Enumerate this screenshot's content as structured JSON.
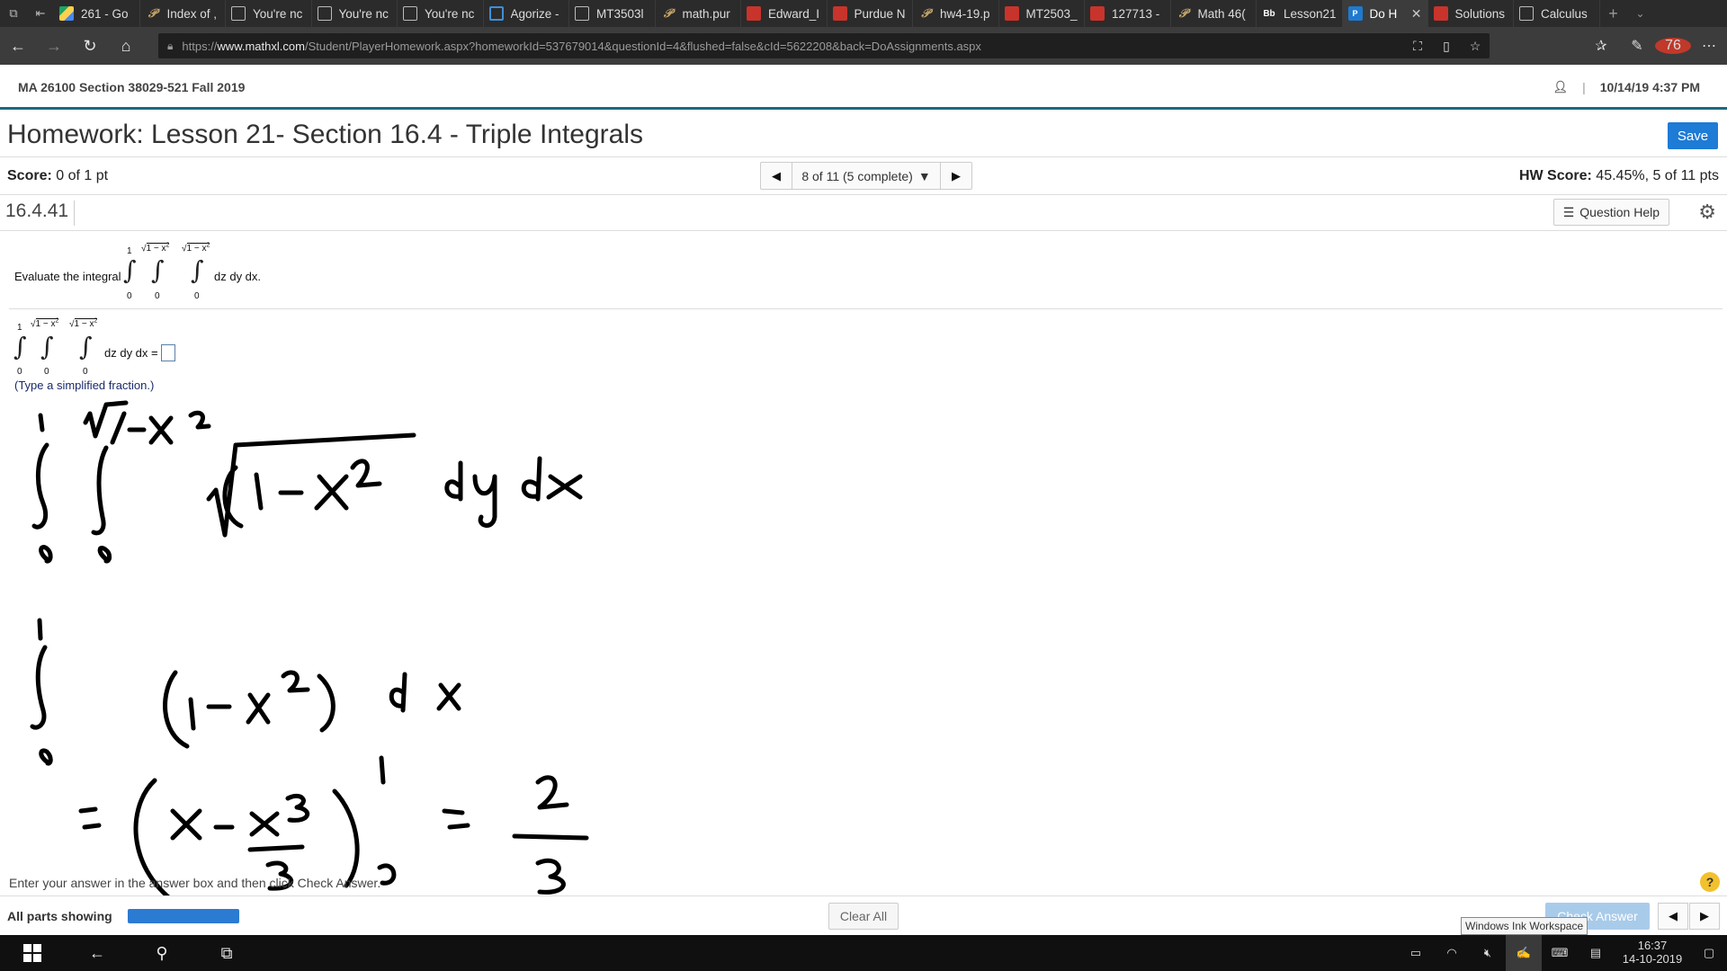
{
  "browser": {
    "tabs": [
      {
        "label": "261 - Go",
        "icon": "drive-icon"
      },
      {
        "label": "Index of ,",
        "icon": "p-icon"
      },
      {
        "label": "You're nc",
        "icon": "page-icon"
      },
      {
        "label": "You're nc",
        "icon": "page-icon"
      },
      {
        "label": "You're nc",
        "icon": "page-icon"
      },
      {
        "label": "Agorize -",
        "icon": "ring-icon"
      },
      {
        "label": "MT3503l",
        "icon": "page-icon"
      },
      {
        "label": "math.pur",
        "icon": "p-icon"
      },
      {
        "label": "Edward_I",
        "icon": "pdf-icon"
      },
      {
        "label": "Purdue N",
        "icon": "pdf-icon"
      },
      {
        "label": "hw4-19.p",
        "icon": "p-icon"
      },
      {
        "label": "MT2503_",
        "icon": "pdf-icon"
      },
      {
        "label": "127713 -",
        "icon": "pdf-icon"
      },
      {
        "label": "Math 46(",
        "icon": "p-icon"
      },
      {
        "label": "Lesson21",
        "icon": "bb-icon",
        "icon_text": "Bb"
      },
      {
        "label": "Do H",
        "icon": "pearson-icon",
        "icon_text": "P",
        "active": true
      },
      {
        "label": "Solutions",
        "icon": "pdf-icon"
      },
      {
        "label": "Calculus",
        "icon": "page-icon"
      }
    ],
    "url_prefix": "https://",
    "url_host": "www.mathxl.com",
    "url_path": "/Student/PlayerHomework.aspx?homeworkId=537679014&questionId=4&flushed=false&cId=5622208&back=DoAssignments.aspx",
    "profile_badge": "76"
  },
  "header": {
    "course": "MA 26100 Section 38029-521 Fall 2019",
    "datetime": "10/14/19 4:37 PM",
    "separator": "|"
  },
  "homework": {
    "title": "Homework: Lesson 21- Section 16.4 - Triple Integrals",
    "save_label": "Save",
    "score_label": "Score:",
    "score_value": " 0 of 1 pt",
    "hw_score_label": "HW Score:",
    "hw_score_value": " 45.45%, 5 of 11 pts",
    "question_nav": "8 of 11 (5 complete)",
    "question_id": "16.4.41",
    "question_help": "Question Help"
  },
  "question": {
    "prompt": "Evaluate the integral",
    "upper_outer": "1",
    "upper_mid": "1 − x",
    "upper_inner": "1 − x",
    "exp": "2",
    "lower": "0",
    "differentials": "dz dy dx.",
    "answer_differentials": "dz dy dx =",
    "hint": "(Type a simplified fraction.)"
  },
  "footer": {
    "instructions": "Enter your answer in the answer box and then click Check Answer.",
    "parts_label": "All parts showing",
    "clear_all": "Clear All",
    "check_answer": "Check Answer",
    "ink_tooltip": "Windows Ink Workspace",
    "help": "?"
  },
  "taskbar": {
    "time": "16:37",
    "date": "14-10-2019"
  },
  "colors": {
    "accent_blue": "#1e7bd6",
    "header_rule": "#1b6b82",
    "ink": "#000000"
  }
}
